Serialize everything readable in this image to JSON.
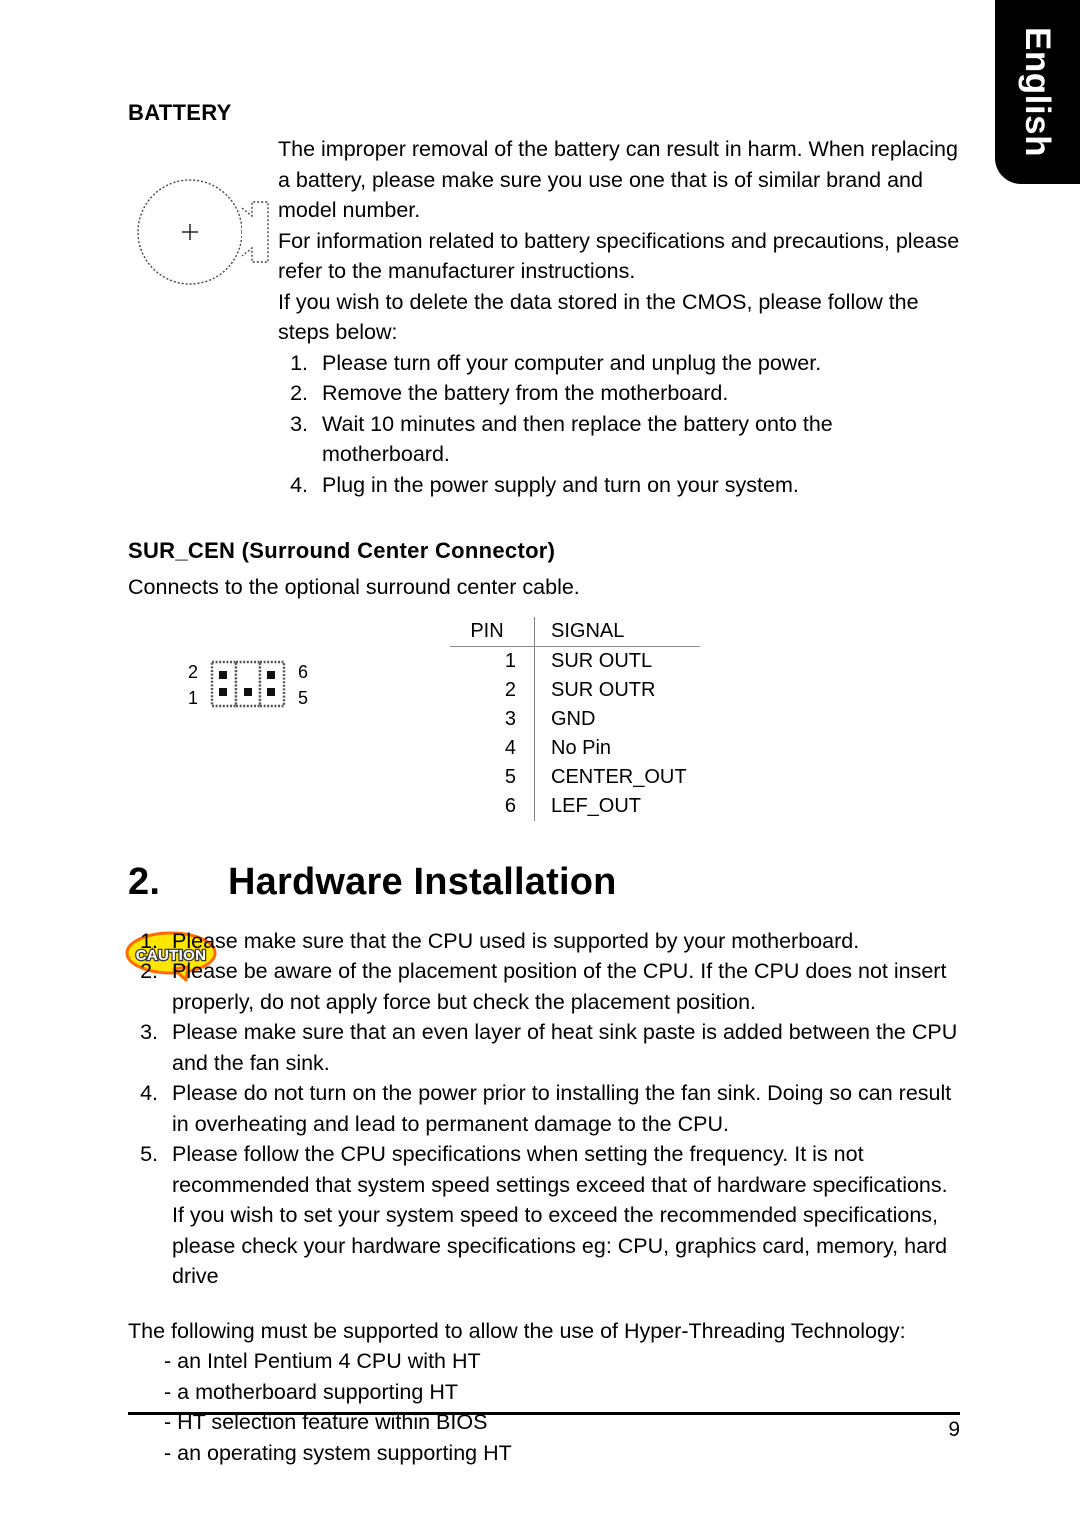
{
  "language_tab": {
    "label": "English"
  },
  "battery_section": {
    "heading": "BATTERY",
    "icon_name": "coin-battery-illustration",
    "polarity_mark": "+",
    "paragraphs": [
      "The improper removal of the battery can result in harm.  When replacing a battery, please make sure you use one that is of similar brand and model number.",
      "For information related to battery specifications and precautions, please refer to the manufacturer instructions.",
      "If you wish to delete the data stored in the CMOS, please follow the steps below:"
    ],
    "steps": [
      {
        "num": "1.",
        "text": "Please turn off your computer and unplug the power."
      },
      {
        "num": "2.",
        "text": "Remove the battery from the motherboard."
      },
      {
        "num": "3.",
        "text": "Wait 10 minutes and then replace the battery onto the motherboard."
      },
      {
        "num": "4.",
        "text": "Plug in the power supply and turn on your system."
      }
    ]
  },
  "surcen_section": {
    "heading": "SUR_CEN (Surround Center Connector)",
    "description": "Connects to the optional surround center cable.",
    "pin_header_labels": {
      "top_left": "2",
      "top_right": "6",
      "bottom_left": "1",
      "bottom_right": "5"
    },
    "table": {
      "columns": [
        "PIN",
        "SIGNAL"
      ],
      "rows": [
        {
          "pin": "1",
          "signal": "SUR OUTL"
        },
        {
          "pin": "2",
          "signal": "SUR OUTR"
        },
        {
          "pin": "3",
          "signal": "GND"
        },
        {
          "pin": "4",
          "signal": "No Pin"
        },
        {
          "pin": "5",
          "signal": "CENTER_OUT"
        },
        {
          "pin": "6",
          "signal": "LEF_OUT"
        }
      ]
    }
  },
  "chapter": {
    "number": "2.",
    "title": "Hardware Installation"
  },
  "caution": {
    "icon_label": "CAUTION",
    "bubble_fill": "#FFE600",
    "bubble_stroke": "#FF6A00",
    "items": [
      {
        "num": "1.",
        "text": "Please make sure that the CPU used is supported by your motherboard."
      },
      {
        "num": "2.",
        "text": "Please be aware of the placement position of the CPU.  If the CPU does not insert properly, do not apply force but check the placement position."
      },
      {
        "num": "3.",
        "text": "Please make sure that an even layer of heat sink paste is added between the CPU and the fan sink."
      },
      {
        "num": "4.",
        "text": "Please do not turn on the power prior to installing the fan sink.  Doing so can result in overheating and lead to permanent damage to the CPU."
      },
      {
        "num": "5.",
        "text": "Please follow the CPU specifications when setting the frequency.  It is not recommended that system speed settings exceed that of hardware specifications.  If you wish to set your system speed to exceed the recommended specifications,  please check your hardware specifications eg: CPU, graphics card, memory, hard drive"
      }
    ]
  },
  "hyperthreading": {
    "lead": "The following must be supported to allow the use of Hyper-Threading Technology:",
    "items": [
      "- an Intel Pentium 4 CPU with HT",
      "- a motherboard supporting HT",
      "- HT selection feature within BIOS",
      "- an operating system supporting HT"
    ]
  },
  "footer": {
    "page_number": "9"
  }
}
